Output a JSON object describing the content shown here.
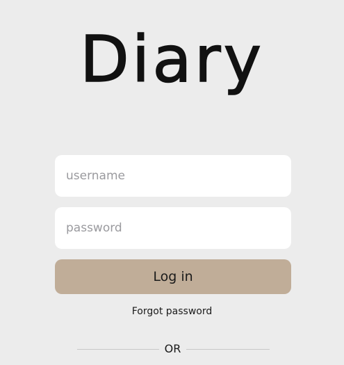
{
  "app": {
    "logo_text": "Diary"
  },
  "login_form": {
    "username_placeholder": "username",
    "password_placeholder": "password",
    "login_button_label": "Log in",
    "forgot_password_label": "Forgot password"
  },
  "divider": {
    "label": "OR"
  },
  "colors": {
    "background": "#ececec",
    "input_background": "#ffffff",
    "login_button": "#c0ad98",
    "placeholder_text": "#9a9a9e",
    "text": "#1a1a1a"
  }
}
